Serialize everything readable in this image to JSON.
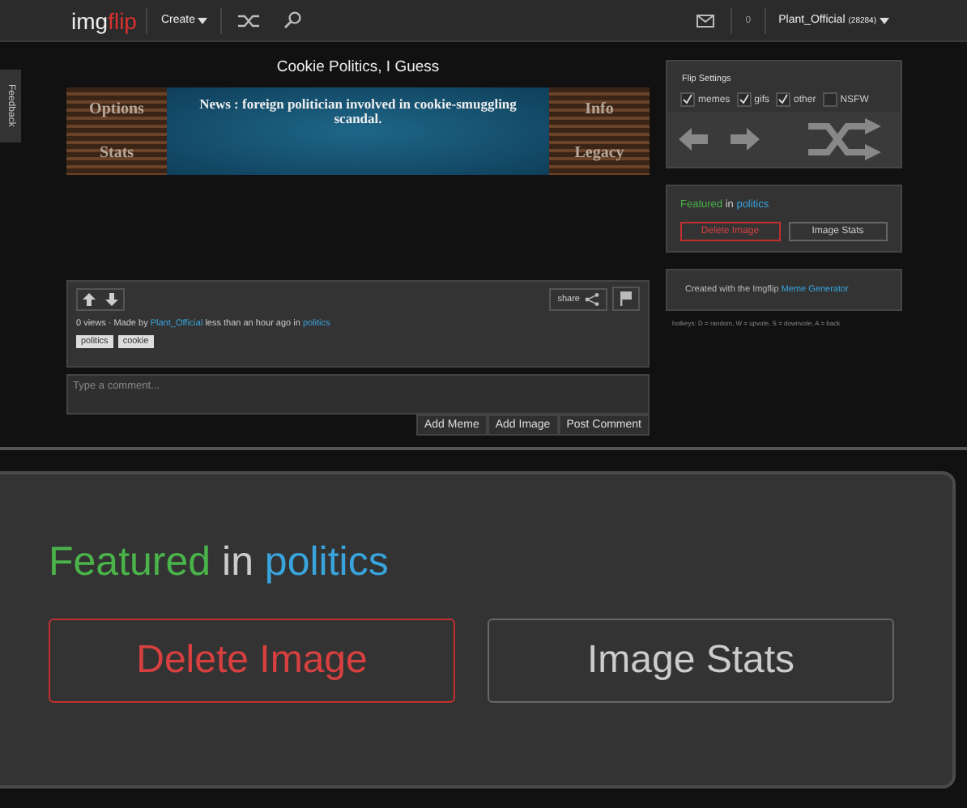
{
  "navbar": {
    "logo": {
      "part_1": "img",
      "part_2": "flip"
    },
    "create_menu": "Create",
    "notification_count": "0",
    "username": "Plant_Official",
    "user_points": "(28284)"
  },
  "feedback_tab": "Feedback",
  "meme": {
    "title": "Cookie Politics, I Guess",
    "game_screen": {
      "left_buttons": [
        "Options",
        "Stats"
      ],
      "right_buttons": [
        "Info",
        "Legacy"
      ],
      "news": "News : foreign politician involved in cookie-smuggling scandal."
    }
  },
  "post": {
    "share": "share",
    "stats": {
      "views": "0 views",
      "made_by": "· Made by",
      "author": "Plant_Official",
      "time": "less than an hour ago in",
      "category": "politics"
    },
    "tags": [
      "politics",
      "cookie"
    ]
  },
  "comment": {
    "placeholder": "Type a comment...",
    "buttons": [
      "Add Meme",
      "Add Image",
      "Post Comment"
    ]
  },
  "sidebar": {
    "flip_settings": {
      "title": "Flip Settings",
      "options": [
        {
          "label": "memes",
          "checked": true
        },
        {
          "label": "gifs",
          "checked": true
        },
        {
          "label": "other",
          "checked": true
        },
        {
          "label": "NSFW",
          "checked": false
        }
      ]
    },
    "featured": {
      "label": "Featured",
      "in": "in",
      "category": "politics",
      "buttons": [
        {
          "label": "Delete Image",
          "kind": "danger"
        },
        {
          "label": "Image Stats",
          "kind": "normal"
        }
      ]
    },
    "created_with": {
      "text": "Created with the Imgflip",
      "link": "Meme Generator"
    },
    "hotkeys": "hotkeys: D = random, W = upvote, S = downvote, A = back"
  },
  "zoomed_panel": {
    "label": "Featured",
    "in": "in",
    "category": "politics",
    "buttons": [
      {
        "label": "Delete Image",
        "kind": "danger"
      },
      {
        "label": "Image Stats",
        "kind": "normal"
      }
    ]
  }
}
